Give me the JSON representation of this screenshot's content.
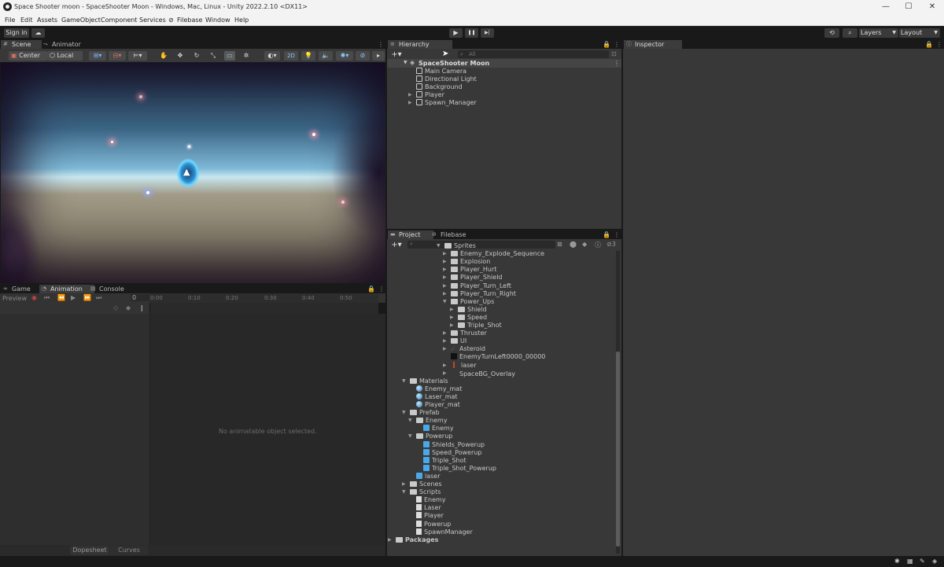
{
  "window": {
    "title": "Space Shooter moon - SpaceShooter Moon - Windows, Mac, Linux - Unity 2022.2.10 <DX11>",
    "minimize": "—",
    "maximize": "☐",
    "close": "✕"
  },
  "menu": [
    "File",
    "Edit",
    "Assets",
    "GameObject",
    "Component",
    "Services",
    "Filebase",
    "Window",
    "Help"
  ],
  "toolbar": {
    "sign_in": "Sign in",
    "play": "▶",
    "pause": "❚❚",
    "step": "▶|",
    "layers": "Layers",
    "layout": "Layout"
  },
  "scene_panel": {
    "tabs": [
      "Scene",
      "Animator"
    ],
    "pivot": "Center",
    "space": "Local",
    "mode_2d": "2D"
  },
  "bottom_panel": {
    "tabs": [
      "Game",
      "Animation",
      "Console"
    ],
    "preview": "Preview",
    "frame": "0",
    "timeline_ticks": [
      "0:00",
      "0:10",
      "0:20",
      "0:30",
      "0:40",
      "0:50"
    ],
    "empty_message": "No animatable object selected.",
    "dopesheet": "Dopesheet",
    "curves": "Curves"
  },
  "hierarchy": {
    "tab": "Hierarchy",
    "search_placeholder": "All",
    "scene_name": "SpaceShooter Moon",
    "items": [
      "Main Camera",
      "Directional Light",
      "Background",
      "Player",
      "Spawn_Manager"
    ]
  },
  "inspector": {
    "tab": "Inspector"
  },
  "project": {
    "tabs": [
      "Project",
      "Filebase"
    ],
    "hidden_count": "3",
    "rows": [
      {
        "label": "Sprites",
        "icon": "folder"
      },
      {
        "label": "Enemy_Explode_Sequence",
        "icon": "folder"
      },
      {
        "label": "Explosion",
        "icon": "folder"
      },
      {
        "label": "Player_Hurt",
        "icon": "folder"
      },
      {
        "label": "Player_Shield",
        "icon": "folder"
      },
      {
        "label": "Player_Turn_Left",
        "icon": "folder"
      },
      {
        "label": "Player_Turn_Right",
        "icon": "folder"
      },
      {
        "label": "Power_Ups",
        "icon": "folder"
      },
      {
        "label": "Shield",
        "icon": "folder"
      },
      {
        "label": "Speed",
        "icon": "folder"
      },
      {
        "label": "Triple_Shot",
        "icon": "folder"
      },
      {
        "label": "Thruster",
        "icon": "folder"
      },
      {
        "label": "UI",
        "icon": "folder"
      },
      {
        "label": "Asteroid",
        "icon": "asteroid"
      },
      {
        "label": "EnemyTurnLeft0000_00000",
        "icon": "image"
      },
      {
        "label": "laser",
        "icon": "laser"
      },
      {
        "label": "SpaceBG_Overlay",
        "icon": "blank"
      },
      {
        "label": "Materials",
        "icon": "folder"
      },
      {
        "label": "Enemy_mat",
        "icon": "material"
      },
      {
        "label": "Laser_mat",
        "icon": "material"
      },
      {
        "label": "Player_mat",
        "icon": "material"
      },
      {
        "label": "Prefab",
        "icon": "folder"
      },
      {
        "label": "Enemy",
        "icon": "folder"
      },
      {
        "label": "Enemy",
        "icon": "prefab"
      },
      {
        "label": "Powerup",
        "icon": "folder"
      },
      {
        "label": "Shields_Powerup",
        "icon": "prefab"
      },
      {
        "label": "Speed_Powerup",
        "icon": "prefab"
      },
      {
        "label": "Triple_Shot",
        "icon": "prefab"
      },
      {
        "label": "Triple_Shot_Powerup",
        "icon": "prefab"
      },
      {
        "label": "laser",
        "icon": "prefab"
      },
      {
        "label": "Scenes",
        "icon": "folder"
      },
      {
        "label": "Scripts",
        "icon": "folder"
      },
      {
        "label": "Enemy",
        "icon": "script"
      },
      {
        "label": "Laser",
        "icon": "script"
      },
      {
        "label": "Player",
        "icon": "script"
      },
      {
        "label": "Powerup",
        "icon": "script"
      },
      {
        "label": "SpawnManager",
        "icon": "script"
      },
      {
        "label": "Packages",
        "icon": "folder"
      }
    ]
  }
}
